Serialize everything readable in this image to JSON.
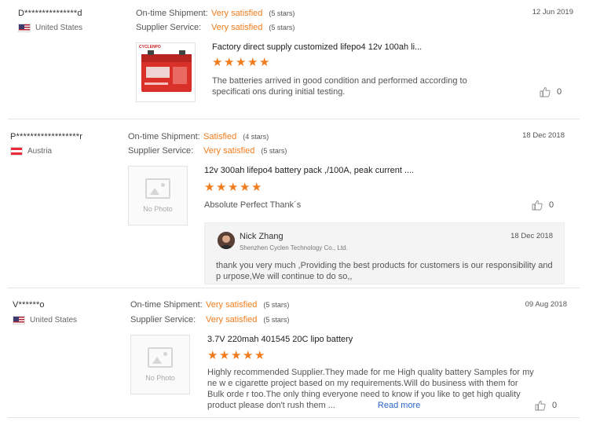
{
  "reviews": [
    {
      "buyer": "D***************d",
      "country": "United States",
      "flag": "flag-us-icon",
      "date": "12 Jun 2019",
      "shipment_label": "On-time Shipment:",
      "shipment_value": "Very satisfied",
      "shipment_stars": "(5 stars)",
      "service_label": "Supplier Service:",
      "service_value": "Very satisfied",
      "service_stars": "(5 stars)",
      "product_title": "Factory direct supply customized lifepo4 12v 100ah li...",
      "product_brand": "CYCLENPO",
      "rating": 5,
      "feedback": "The batteries arrived in good condition and performed according to specificati ons during initial testing.",
      "helpful_count": "0"
    },
    {
      "buyer": "P******************r",
      "country": "Austria",
      "flag": "flag-at-icon",
      "date": "18 Dec 2018",
      "shipment_label": "On-time Shipment:",
      "shipment_value": "Satisfied",
      "shipment_stars": "(4 stars)",
      "service_label": "Supplier Service:",
      "service_value": "Very satisfied",
      "service_stars": "(5 stars)",
      "no_photo": "No Photo",
      "product_title": "12v 300ah lifepo4 battery pack ,/100A, peak current ....",
      "rating": 5,
      "feedback": "Absolute Perfect Thank´s",
      "helpful_count": "0",
      "reply": {
        "name": "Nick Zhang",
        "company": "Shenzhen Cyclen Technology Co., Ltd.",
        "date": "18 Dec 2018",
        "text": "thank you very much ,Providing the best products for customers is our responsibility and p urpose,We will continue to do so,,"
      }
    },
    {
      "buyer": "V******o",
      "country": "United States",
      "flag": "flag-us-icon",
      "date": "09 Aug 2018",
      "shipment_label": "On-time Shipment:",
      "shipment_value": "Very satisfied",
      "shipment_stars": "(5 stars)",
      "service_label": "Supplier Service:",
      "service_value": "Very satisfied",
      "service_stars": "(5 stars)",
      "no_photo": "No Photo",
      "product_title": "3.7V 220mah 401545 20C lipo battery",
      "rating": 5,
      "feedback": "Highly recommended Supplier.They made for me High quality battery Samples for my ne w e cigarette project based on my requirements.Will do business with them for Bulk orde r too.The only thing everyone need to know if you like to get high quality product please don't rush them ...",
      "read_more": "Read more",
      "helpful_count": "0"
    }
  ],
  "colors": {
    "accent": "#f07c1d",
    "link": "#2b66c4"
  }
}
